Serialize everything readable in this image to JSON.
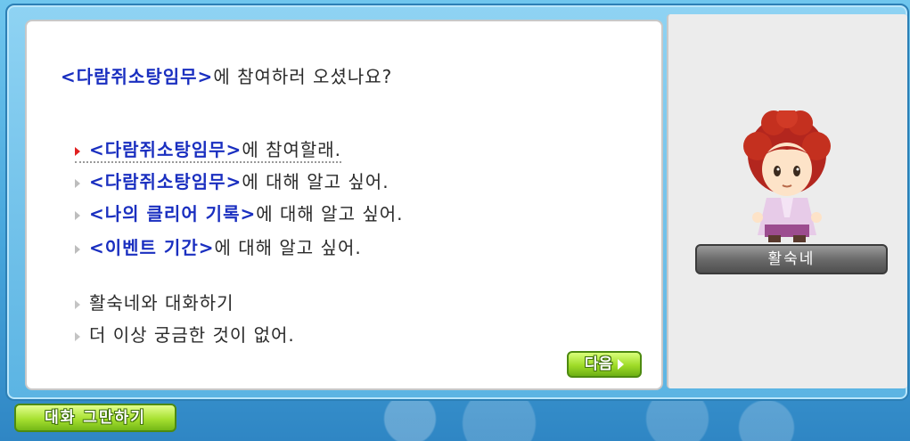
{
  "dialog": {
    "intro": {
      "highlight": "<다람쥐소탕임무>",
      "rest": "에 참여하러 오셨나요?"
    },
    "options": [
      {
        "highlight": "<다람쥐소탕임무>",
        "rest": "에 참여할래.",
        "selected": true
      },
      {
        "highlight": "<다람쥐소탕임무>",
        "rest": "에 대해 알고 싶어.",
        "selected": false
      },
      {
        "highlight": "<나의 클리어 기록>",
        "rest": "에 대해 알고 싶어.",
        "selected": false
      },
      {
        "highlight": "<이벤트 기간>",
        "rest": "에 대해 알고 싶어.",
        "selected": false
      }
    ],
    "plain_options": [
      "활숙네와 대화하기",
      "더 이상 궁금한 것이 없어."
    ],
    "next_label": "다음"
  },
  "npc": {
    "name": "활숙네"
  },
  "footer": {
    "end_chat_label": "대화 그만하기"
  },
  "colors": {
    "highlight": "#1a2fc0",
    "button_green": "#9fdb28",
    "frame_blue": "#5bb4e3"
  }
}
